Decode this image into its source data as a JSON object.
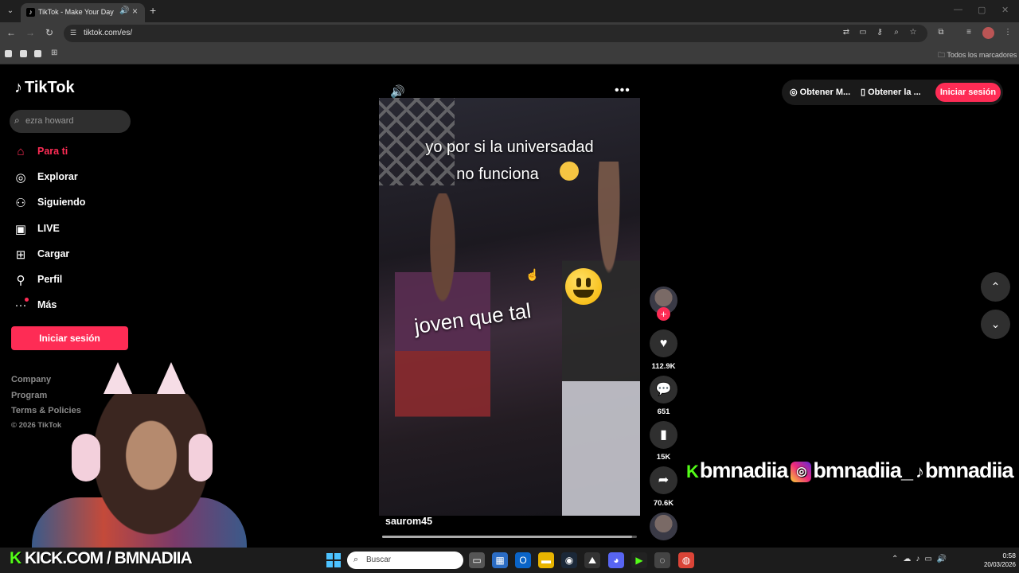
{
  "browser": {
    "tab_title": "TikTok - Make Your Day",
    "url": "tiktok.com/es/",
    "all_bookmarks_label": "Todos los marcadores"
  },
  "sidebar": {
    "logo_text": "TikTok",
    "search_placeholder": "ezra howard",
    "nav_items": [
      {
        "label": "Para ti",
        "icon": "home-icon"
      },
      {
        "label": "Explorar",
        "icon": "compass-icon"
      },
      {
        "label": "Siguiendo",
        "icon": "following-icon"
      },
      {
        "label": "LIVE",
        "icon": "live-icon"
      },
      {
        "label": "Cargar",
        "icon": "upload-icon"
      },
      {
        "label": "Perfil",
        "icon": "profile-icon"
      },
      {
        "label": "Más",
        "icon": "more-icon"
      }
    ],
    "login_button": "Iniciar sesión",
    "footer_links": [
      "Company",
      "Program",
      "Terms & Policies"
    ],
    "copyright": "© 2026 TikTok"
  },
  "header": {
    "get_coins": "Obtener M...",
    "get_app": "Obtener la ...",
    "login_button": "Iniciar sesión"
  },
  "video": {
    "caption_top_line1": "yo por si la universadad",
    "caption_top_line2": "no funciona",
    "caption_middle": "joven que tal",
    "author": "saurom45",
    "progress_fraction": 0.98
  },
  "actions": {
    "likes": "112.9K",
    "comments": "651",
    "saves": "15K",
    "shares": "70.6K"
  },
  "overlay": {
    "kick_handle": "bmnadiia",
    "instagram_handle": "bmnadiia_",
    "tiktok_handle": "bmnadiia",
    "kick_banner": "KICK.COM / BMNADIIA"
  },
  "taskbar": {
    "search_placeholder": "Buscar",
    "time": "0:58",
    "date": "20/03/2026"
  },
  "colors": {
    "accent": "#fe2c55",
    "kick_green": "#53fc18"
  }
}
